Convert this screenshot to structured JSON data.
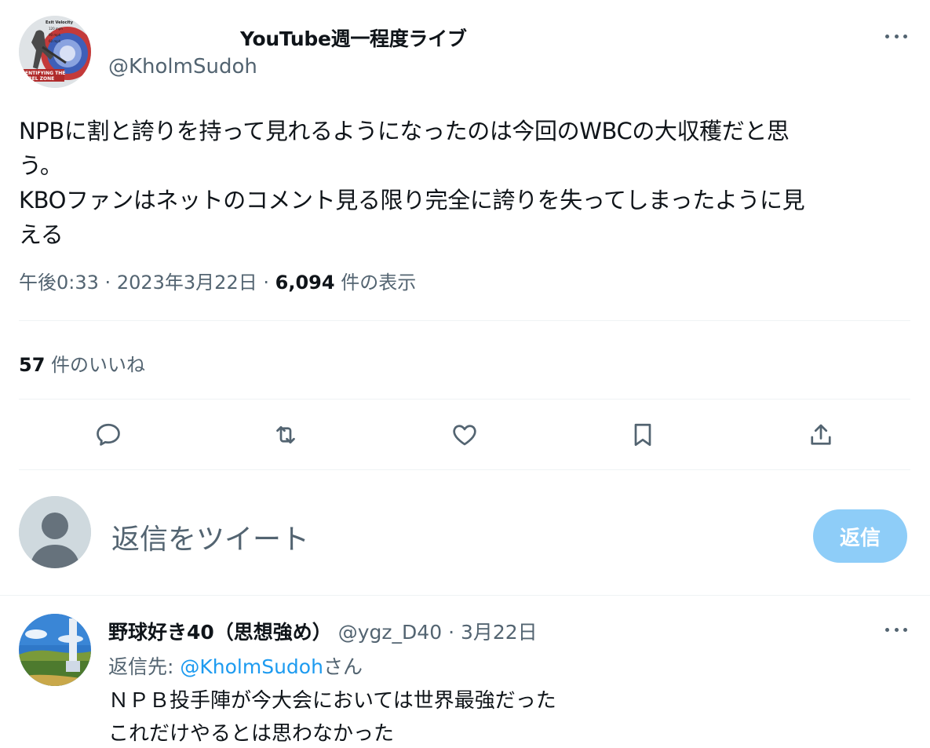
{
  "tweet": {
    "author_name": "YouTube週一程度ライブ",
    "author_handle": "@KholmSudoh",
    "text": "NPBに割と誇りを持って見れるようになったのは今回のWBCの大収穫だと思\nう。\nKBOファンはネットのコメント見る限り完全に誇りを失ってしまったように見\nえる",
    "time": "午後0:33",
    "sep": "·",
    "date": "2023年3月22日",
    "views_count": "6,094",
    "views_label": "件の表示",
    "likes_count": "57",
    "likes_label": "件のいいね",
    "avatar_texts": {
      "velocity": "Exit Velocity",
      "v1": "120 mph",
      "v2": "90 mph",
      "v3": "60 mph",
      "zone1": "ENTIFYING THE",
      "zone2": "REL ZONE"
    }
  },
  "actions": {
    "reply_icon": "reply-icon",
    "retweet_icon": "retweet-icon",
    "like_icon": "heart-icon",
    "bookmark_icon": "bookmark-icon",
    "share_icon": "share-icon"
  },
  "compose": {
    "placeholder": "返信をツイート",
    "button_label": "返信"
  },
  "reply": {
    "author_name": "野球好き40（思想強め）",
    "author_handle": "@ygz_D40",
    "sep": "·",
    "date": "3月22日",
    "reply_to_prefix": "返信先: ",
    "reply_to_mention": "@KholmSudoh",
    "reply_to_suffix": "さん",
    "text": "ＮＰＢ投手陣が今大会においては世界最強だった\nこれだけやるとは思わなかった"
  },
  "colors": {
    "text": "#0f1419",
    "secondary": "#536471",
    "accent": "#1d9bf0",
    "button_disabled": "#8ecdf8",
    "divider": "#eff3f4"
  }
}
